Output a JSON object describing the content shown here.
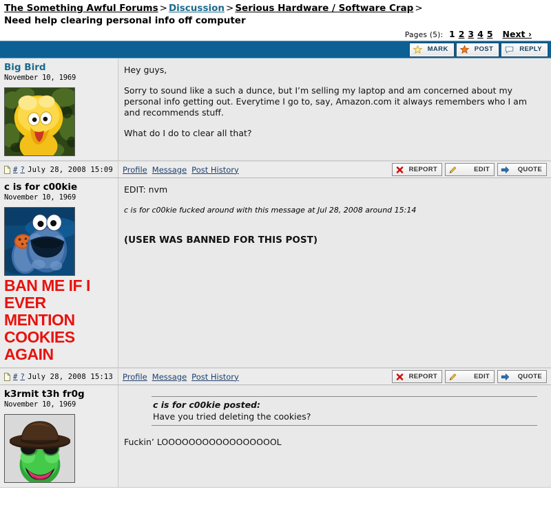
{
  "header": {
    "breadcrumb": [
      {
        "label": "The Something Awful Forums",
        "style": "home"
      },
      {
        "label": "Discussion",
        "style": "link"
      },
      {
        "label": "Serious Hardware / Software Crap",
        "style": "home"
      }
    ],
    "separator": ">",
    "thread_title": "Need help clearing personal info off computer"
  },
  "pagination": {
    "label": "Pages (5):",
    "pages": [
      "1",
      "2",
      "3",
      "4",
      "5"
    ],
    "current": "1",
    "next_label": "Next ›"
  },
  "actionbar": {
    "buttons": [
      {
        "label": "MARK",
        "icon": "star-outline-icon"
      },
      {
        "label": "POST",
        "icon": "star-filled-icon"
      },
      {
        "label": "REPLY",
        "icon": "speech-bubble-icon"
      }
    ],
    "bar_color": "#0c6094"
  },
  "footer_links": [
    "Profile",
    "Message",
    "Post History"
  ],
  "footer_buttons": [
    {
      "label": "REPORT",
      "icon": "red-x-icon"
    },
    {
      "label": "EDIT",
      "icon": "pencil-icon"
    },
    {
      "label": "QUOTE",
      "icon": "blue-arrow-icon"
    }
  ],
  "footer_marks": {
    "hash": "#",
    "question": "?"
  },
  "posts": [
    {
      "username": "Big Bird",
      "name_color": "blue",
      "register_date": "November 10, 1969",
      "avatar": "big-bird-avatar",
      "timestamp": "July 28, 2008 15:09",
      "paragraphs": [
        "Hey guys,",
        "Sorry to sound like a such a dunce, but I’m selling my laptop and am concerned about my personal info getting out.  Everytime I go to, say, Amazon.com it always remembers who I am and recommends stuff.",
        "What do I do to clear all that?"
      ]
    },
    {
      "username": "c is for c00kie",
      "name_color": "black",
      "register_date": "November 10, 1969",
      "avatar": "cookie-monster-avatar",
      "signature_text": "BAN ME IF I EVER MENTION COOKIES AGAIN",
      "signature_color": "#e8120e",
      "timestamp": "July 28, 2008 15:13",
      "paragraphs": [
        "EDIT: nvm"
      ],
      "edit_note": "c is for c00kie fucked around with this message at Jul 28, 2008 around 15:14",
      "banned_note": "(USER WAS BANNED FOR THIS POST)"
    },
    {
      "username": "k3rmit t3h fr0g",
      "name_color": "black",
      "register_date": "November 10, 1969",
      "avatar": "kermit-avatar",
      "quote": {
        "attribution": "c is for c00kie posted:",
        "text": "Have you tried deleting the cookies?"
      },
      "paragraphs": [
        "Fuckin’ LOOOOOOOOOOOOOOOOOL"
      ]
    }
  ]
}
